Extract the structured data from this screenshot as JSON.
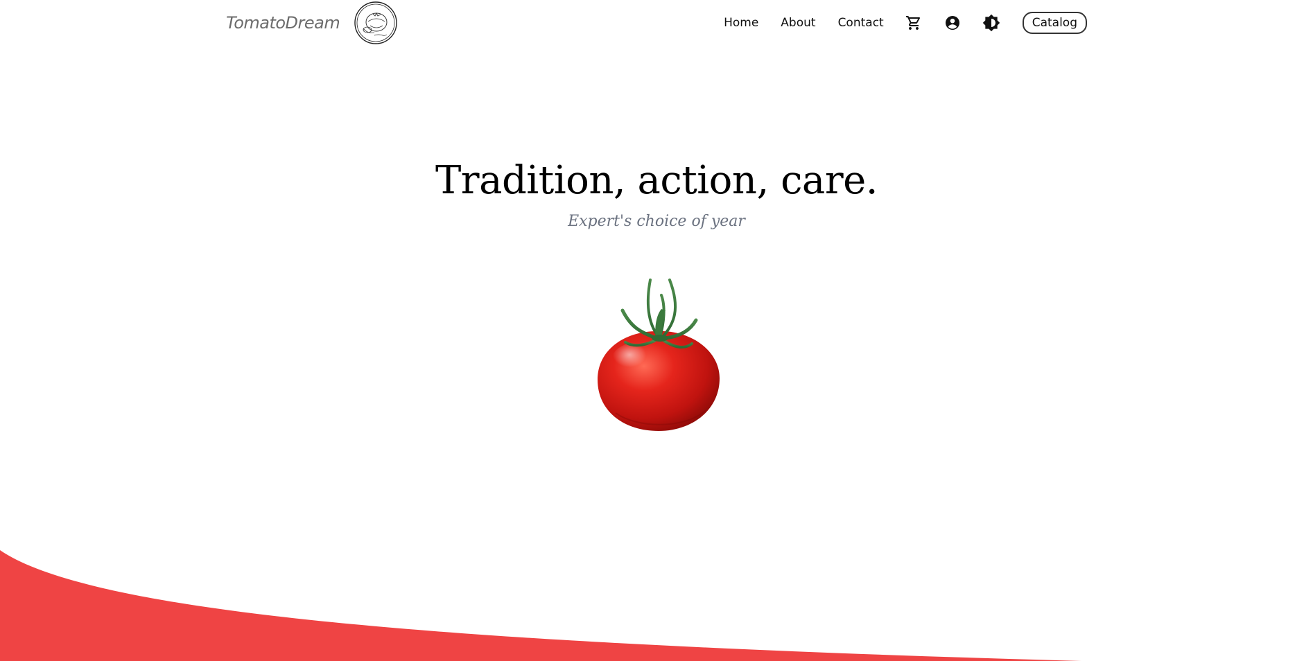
{
  "header": {
    "brand_name": "TomatoDream",
    "nav": {
      "home": "Home",
      "about": "About",
      "contact": "Contact",
      "catalog": "Catalog"
    },
    "icons": {
      "cart": "cart-icon",
      "account": "account-circle-icon",
      "theme": "theme-toggle-icon"
    }
  },
  "hero": {
    "title": "Tradition, action, care.",
    "subtitle": "Expert's choice of year"
  },
  "colors": {
    "accent_red": "#ef4444",
    "subtitle_gray": "#6b7280",
    "brand_gray": "#6b6b6b"
  }
}
